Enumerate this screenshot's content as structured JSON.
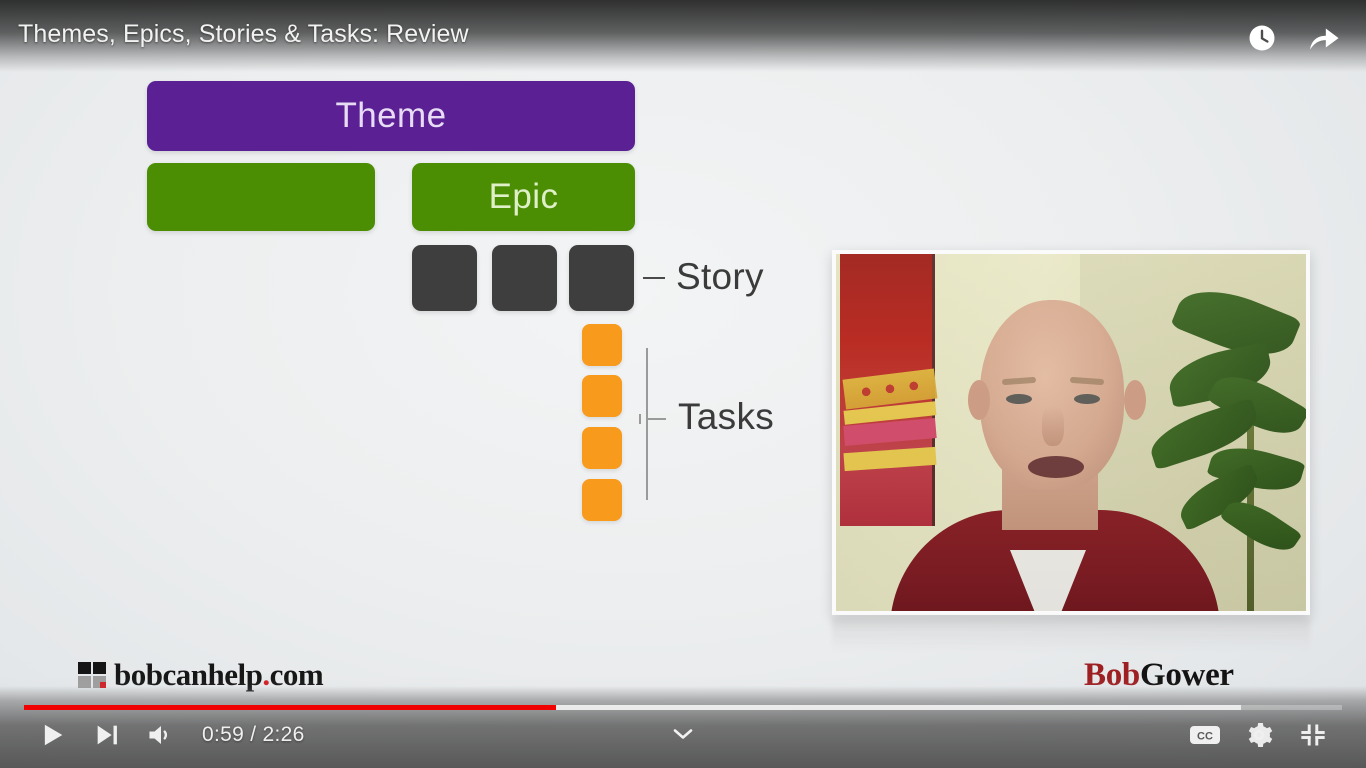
{
  "player": {
    "title": "Themes, Epics, Stories & Tasks: Review",
    "top_actions": [
      {
        "name": "watch-later-icon",
        "label": "Watch later"
      },
      {
        "name": "share-icon",
        "label": "Share"
      }
    ],
    "controls": {
      "play_label": "Play",
      "next_label": "Next",
      "volume_label": "Mute",
      "time_display": "0:59 / 2:26",
      "current_time": "0:59",
      "duration": "2:26",
      "captions_label": "CC",
      "settings_label": "Settings",
      "fullscreen_label": "Exit full screen",
      "expand_label": "Show more"
    },
    "progress": {
      "played_percent": 40.4,
      "buffered_percent": 92.3,
      "played_color": "#f10000",
      "buffered_color": "#ffffff"
    }
  },
  "slide": {
    "background_color": "#eceeef",
    "diagram": {
      "theme": {
        "label": "Theme",
        "color": "#5a2094",
        "text_color": "#e8dcf5"
      },
      "epics": [
        {
          "label": "",
          "color": "#4c8e03"
        },
        {
          "label": "Epic",
          "color": "#4c8e03",
          "text_color": "#dff0c8"
        }
      ],
      "stories": {
        "label": "Story",
        "count": 3,
        "color": "#3e3e3e"
      },
      "tasks": {
        "label": "Tasks",
        "count": 4,
        "color": "#f89a1c"
      }
    },
    "branding": {
      "left": {
        "text": "bobcanhelp",
        "dot": ".",
        "tld": "com",
        "accent_color": "#cf2026"
      },
      "right": {
        "first": "Bob",
        "second": "Gower",
        "first_color": "#9e1f22",
        "second_color": "#121212"
      }
    },
    "inset": {
      "alt": "presenter speaking to camera"
    }
  }
}
